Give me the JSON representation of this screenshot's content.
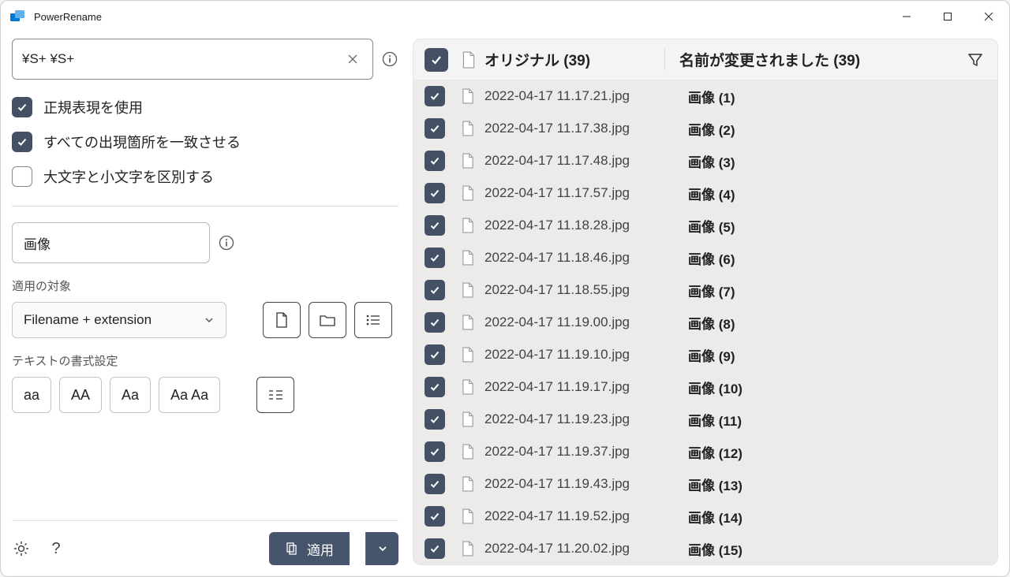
{
  "app": {
    "title": "PowerRename"
  },
  "search": {
    "value": "¥S+ ¥S+"
  },
  "options": {
    "use_regex": {
      "label": "正規表現を使用",
      "checked": true
    },
    "match_all": {
      "label": "すべての出現箇所を一致させる",
      "checked": true
    },
    "case_sensitive": {
      "label": "大文字と小文字を区別する",
      "checked": false
    }
  },
  "replace": {
    "value": "画像"
  },
  "apply_to": {
    "section_label": "適用の対象",
    "selected": "Filename + extension"
  },
  "text_format": {
    "section_label": "テキストの書式設定",
    "buttons": {
      "lower": "aa",
      "upper": "AA",
      "title": "Aa",
      "each": "Aa Aa"
    }
  },
  "apply_button": {
    "label": "適用"
  },
  "table": {
    "header": {
      "original": "オリジナル (39)",
      "renamed": "名前が変更されました (39)"
    },
    "rows": [
      {
        "original": "2022-04-17 11.17.21.jpg",
        "renamed": "画像 (1)"
      },
      {
        "original": "2022-04-17 11.17.38.jpg",
        "renamed": "画像 (2)"
      },
      {
        "original": "2022-04-17 11.17.48.jpg",
        "renamed": "画像 (3)"
      },
      {
        "original": "2022-04-17 11.17.57.jpg",
        "renamed": "画像 (4)"
      },
      {
        "original": "2022-04-17 11.18.28.jpg",
        "renamed": "画像 (5)"
      },
      {
        "original": "2022-04-17 11.18.46.jpg",
        "renamed": "画像 (6)"
      },
      {
        "original": "2022-04-17 11.18.55.jpg",
        "renamed": "画像 (7)"
      },
      {
        "original": "2022-04-17 11.19.00.jpg",
        "renamed": "画像 (8)"
      },
      {
        "original": "2022-04-17 11.19.10.jpg",
        "renamed": "画像 (9)"
      },
      {
        "original": "2022-04-17 11.19.17.jpg",
        "renamed": "画像 (10)"
      },
      {
        "original": "2022-04-17 11.19.23.jpg",
        "renamed": "画像 (11)"
      },
      {
        "original": "2022-04-17 11.19.37.jpg",
        "renamed": "画像 (12)"
      },
      {
        "original": "2022-04-17 11.19.43.jpg",
        "renamed": "画像 (13)"
      },
      {
        "original": "2022-04-17 11.19.52.jpg",
        "renamed": "画像 (14)"
      },
      {
        "original": "2022-04-17 11.20.02.jpg",
        "renamed": "画像 (15)"
      }
    ]
  }
}
